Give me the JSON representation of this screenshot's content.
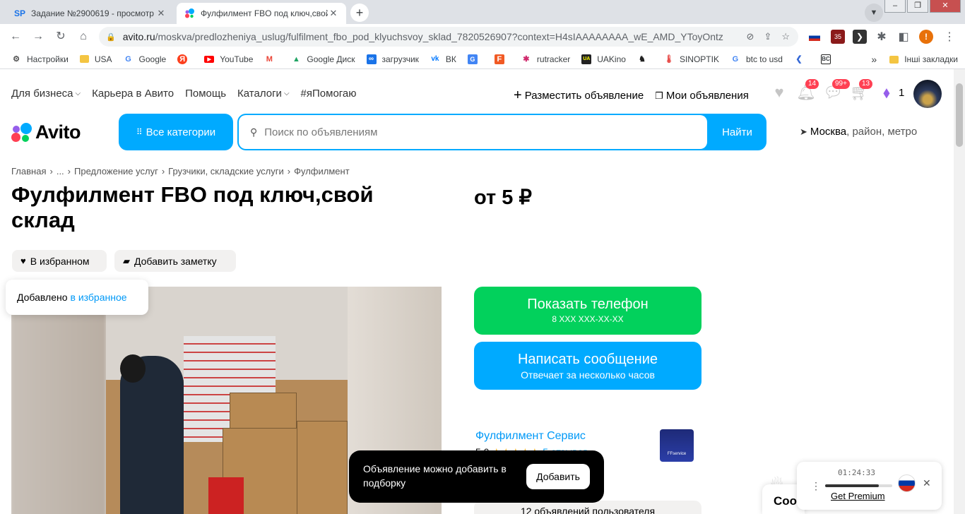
{
  "browser": {
    "tabs": [
      {
        "favicon": "SP",
        "title": "Задание №2900619 - просмотр",
        "close": "✕"
      },
      {
        "favicon": "avito-icon",
        "title": "Фулфилмент FBO под ключ,свой",
        "close": "✕"
      }
    ],
    "new_tab": "+",
    "url_host": "avito.ru",
    "url_rest": "/moskva/predlozheniya_uslug/fulfilment_fbo_pod_klyuchsvoy_sklad_7820526907?context=H4sIAAAAAAAA_wE_AMD_YToyOntzOj...",
    "ext_badge": "35",
    "profile_letter": "!",
    "bookmarks": [
      {
        "label": "Настройки",
        "icon": "gear-icon",
        "color": "#555555"
      },
      {
        "label": "USA",
        "icon": "folder-icon",
        "color": "#f4c542"
      },
      {
        "label": "Google",
        "icon": "google-icon",
        "color": "#4285f4"
      },
      {
        "label": "",
        "icon": "yandex-icon",
        "color": "#fc3f1d"
      },
      {
        "label": "YouTube",
        "icon": "youtube-icon",
        "color": "#ff0000"
      },
      {
        "label": "",
        "icon": "gmail-icon",
        "color": "#ea4335"
      },
      {
        "label": "Google Диск",
        "icon": "drive-icon",
        "color": "#1fa463"
      },
      {
        "label": "загрузчик",
        "icon": "loop-icon",
        "color": "#1a73e8"
      },
      {
        "label": "ВК",
        "icon": "vk-icon",
        "color": "#0077ff"
      },
      {
        "label": "",
        "icon": "translate-icon",
        "color": "#4285f4"
      },
      {
        "label": "",
        "icon": "f-icon",
        "color": "#f15a24"
      },
      {
        "label": "rutracker",
        "icon": "rutracker-icon",
        "color": "#d02a6d"
      },
      {
        "label": "UAKino",
        "icon": "uakino-icon",
        "color": "#222222"
      },
      {
        "label": "",
        "icon": "chess-icon",
        "color": "#222222"
      },
      {
        "label": "SINOPTIK",
        "icon": "thermometer-icon",
        "color": "#e53935"
      },
      {
        "label": "btc to usd",
        "icon": "google-icon",
        "color": "#4285f4"
      },
      {
        "label": "",
        "icon": "arrow-icon",
        "color": "#3367d6"
      },
      {
        "label": "",
        "icon": "bc-icon",
        "color": "#222222"
      }
    ],
    "more_bookmarks": "»",
    "other_bookmarks": "Інші закладки"
  },
  "header": {
    "nav": [
      "Для бизнеса",
      "Карьера в Авито",
      "Помощь",
      "Каталоги",
      "#яПомогаю"
    ],
    "post_ad": "Разместить объявление",
    "my_ads": "Мои объявления",
    "badges": {
      "notifications": "14",
      "messages": "99+",
      "cart": "13"
    },
    "bonus_count": "1",
    "logo_text": "Avito",
    "all_categories": "Все категории",
    "search_placeholder": "Поиск по объявлениям",
    "search_button": "Найти",
    "location_city": "Москва",
    "location_more": ", район, метро"
  },
  "breadcrumb": [
    "Главная",
    "›",
    "...",
    "›",
    "Предложение услуг",
    "›",
    "Грузчики, складские услуги",
    "›",
    "Фулфилмент"
  ],
  "listing": {
    "title": "Фулфилмент FBO под ключ,свой склад",
    "price": "от 5 ₽",
    "favorite_label": "В избранном",
    "note_label": "Добавить заметку",
    "tooltip_text": "Добавлено",
    "tooltip_link": "в избранное"
  },
  "contact": {
    "phone_title": "Показать телефон",
    "phone_mask": "8 XXX XXX-XX-XX",
    "message_title": "Написать сообщение",
    "message_sub": "Отвечает за несколько часов"
  },
  "seller": {
    "name": "Фулфилмент Сервис",
    "rating": "5,0",
    "stars": "★★★★★",
    "reviews": "5 отзывов",
    "logo_text": "FFservice",
    "user_ads": "12 объявлений пользователя"
  },
  "toast": {
    "message": "Объявление можно добавить в подборку",
    "button": "Добавить"
  },
  "cookie_partial": "Coo",
  "vpn": {
    "time": "01:24:33",
    "menu": "⋮",
    "progress": 0.8,
    "premium": "Get Premium",
    "close": "✕"
  },
  "colors": {
    "avito_blue": "#00aaff",
    "avito_green": "#02d15c",
    "badge_red": "#ff4053",
    "link_blue": "#0099f7"
  }
}
